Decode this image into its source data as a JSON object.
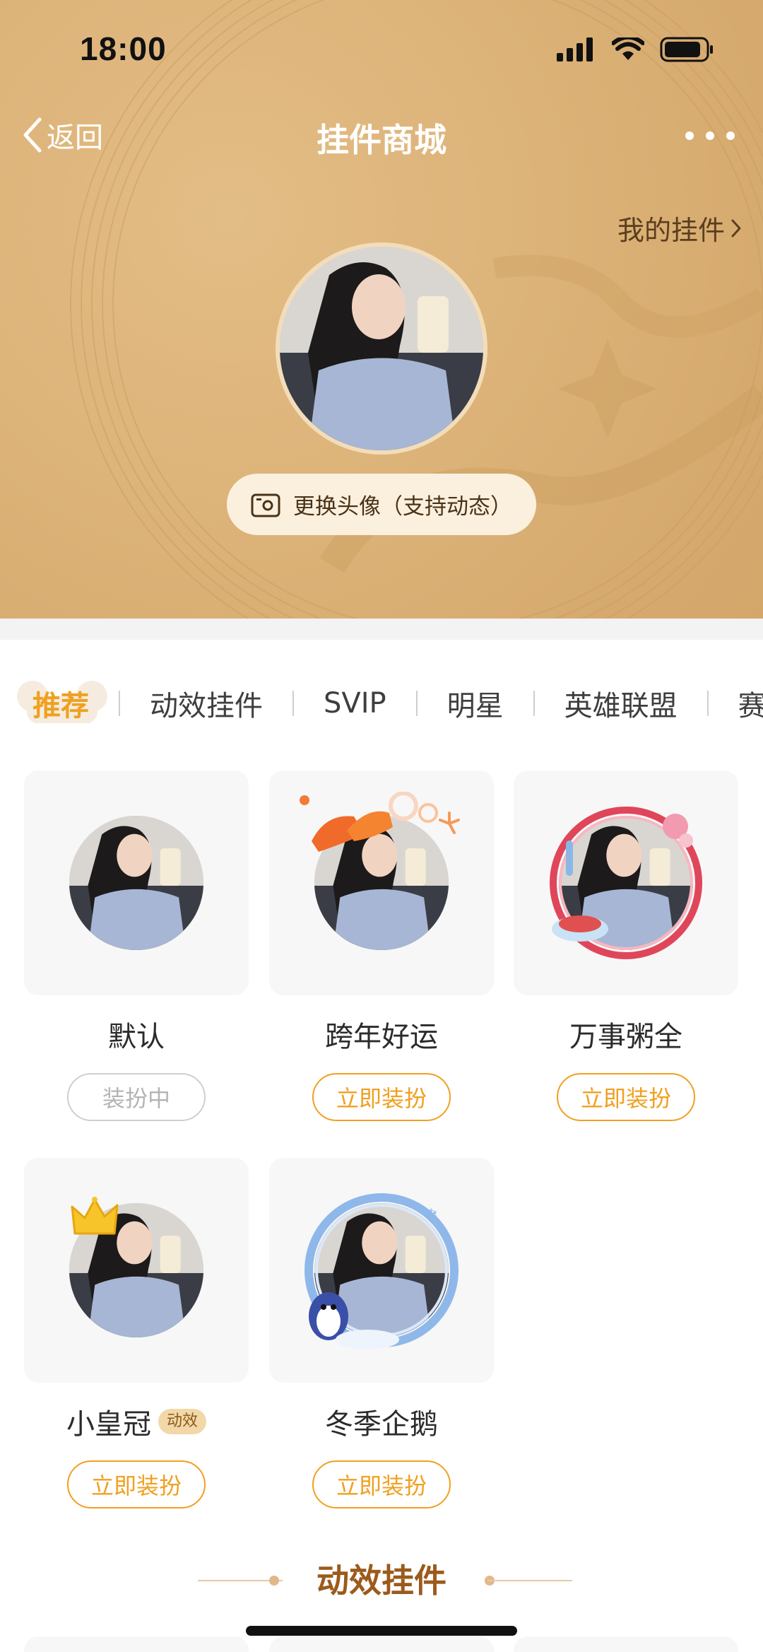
{
  "status_bar": {
    "time": "18:00"
  },
  "nav": {
    "back_label": "返回",
    "title": "挂件商城"
  },
  "header": {
    "my_pendants_label": "我的挂件",
    "change_avatar_label": "更换头像（支持动态）"
  },
  "tabs": [
    {
      "label": "推荐",
      "active": true
    },
    {
      "label": "动效挂件",
      "active": false
    },
    {
      "label": "SVIP",
      "active": false
    },
    {
      "label": "明星",
      "active": false
    },
    {
      "label": "英雄联盟",
      "active": false
    },
    {
      "label": "赛",
      "active": false
    }
  ],
  "pendants": [
    {
      "name": "默认",
      "button": "装扮中",
      "state": "equipped",
      "decoration": "none"
    },
    {
      "name": "跨年好运",
      "button": "立即装扮",
      "state": "available",
      "decoration": "good-luck-text"
    },
    {
      "name": "万事粥全",
      "button": "立即装扮",
      "state": "available",
      "decoration": "porridge-frame"
    },
    {
      "name": "小皇冠",
      "badge": "动效",
      "button": "立即装扮",
      "state": "available",
      "decoration": "crown"
    },
    {
      "name": "冬季企鹅",
      "button": "立即装扮",
      "state": "available",
      "decoration": "penguin-frame"
    }
  ],
  "section": {
    "title": "动效挂件"
  },
  "colors": {
    "accent": "#f0a020",
    "header_bg": "#ddb47a",
    "section_title": "#9b5a1c"
  }
}
